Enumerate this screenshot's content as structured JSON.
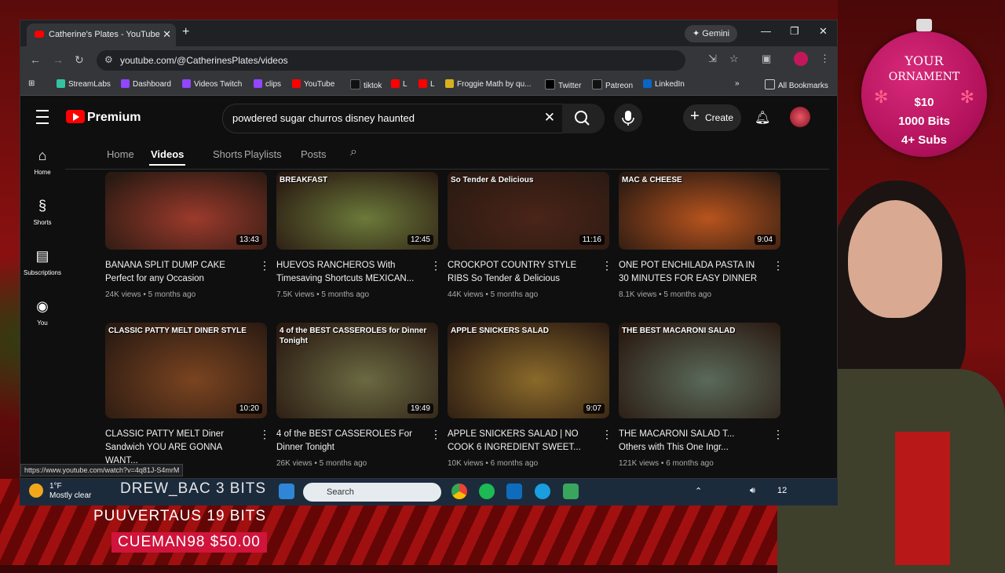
{
  "browser": {
    "tab_title": "Catherine's Plates - YouTube",
    "gemini_label": "Gemini",
    "url": "youtube.com/@CatherinesPlates/videos",
    "bookmarks": [
      "StreamLabs",
      "Dashboard",
      "Videos Twitch",
      "clips",
      "YouTube",
      "tiktok",
      "L",
      "L",
      "Froggie Math by qu...",
      "Twitter",
      "Patreon",
      "LinkedIn"
    ],
    "all_bookmarks": "All Bookmarks",
    "status_url": "https://www.youtube.com/watch?v=4q81J-S4mrM"
  },
  "youtube": {
    "brand": "Premium",
    "search_query": "powdered sugar churros disney haunted",
    "create_label": "Create",
    "sidebar": [
      "Home",
      "Shorts",
      "Subscriptions",
      "You"
    ],
    "tabs": [
      "Home",
      "Videos",
      "Shorts",
      "Playlists",
      "Posts"
    ],
    "videos": [
      {
        "title": "BANANA SPLIT DUMP CAKE Perfect for any Occasion",
        "views": "24K views",
        "age": "5 months ago",
        "duration": "13:43",
        "overlay": "",
        "color": "#9c3a2c"
      },
      {
        "title": "HUEVOS RANCHEROS With Timesaving Shortcuts MEXICAN...",
        "views": "7.5K views",
        "age": "5 months ago",
        "duration": "12:45",
        "overlay": "BREAKFAST",
        "color": "#6b7a3a"
      },
      {
        "title": "CROCKPOT COUNTRY STYLE RIBS So Tender & Delicious",
        "views": "44K views",
        "age": "5 months ago",
        "duration": "11:16",
        "overlay": "So Tender & Delicious",
        "color": "#4a2418"
      },
      {
        "title": "ONE POT ENCHILADA PASTA IN 30 MINUTES FOR EASY DINNER",
        "views": "8.1K views",
        "age": "5 months ago",
        "duration": "9:04",
        "overlay": "MAC & CHEESE",
        "color": "#b8541e"
      },
      {
        "title": "CLASSIC PATTY MELT Diner Sandwich YOU ARE GONNA WANT...",
        "views": "",
        "age": "",
        "duration": "10:20",
        "overlay": "CLASSIC PATTY MELT DINER STYLE",
        "color": "#7a4420"
      },
      {
        "title": "4 of the BEST CASSEROLES For Dinner Tonight",
        "views": "26K views",
        "age": "5 months ago",
        "duration": "19:49",
        "overlay": "4 of the BEST CASSEROLES for Dinner Tonight",
        "color": "#6a6a42"
      },
      {
        "title": "APPLE SNICKERS SALAD | NO COOK 6 INGREDIENT SWEET...",
        "views": "10K views",
        "age": "6 months ago",
        "duration": "9:07",
        "overlay": "APPLE SNICKERS SALAD",
        "color": "#8a6a2a"
      },
      {
        "title": "THE MACARONI SALAD T... Others with This One Ingr...",
        "views": "121K views",
        "age": "6 months ago",
        "duration": "",
        "overlay": "THE BEST MACARONI SALAD",
        "color": "#5a6a5a"
      }
    ]
  },
  "taskbar": {
    "temp": "1°F",
    "weather": "Mostly clear",
    "search": "Search",
    "clock": "12"
  },
  "stream": {
    "alert1": "DREW_BAC  3 BITS",
    "alert2": "PUUVERTAUS  19 BITS",
    "alert3": "CUEMAN98  $50.00",
    "ornament": {
      "l1": "YOUR",
      "l2": "ORNAMENT",
      "l3": "$10",
      "l4": "1000 Bits",
      "l5": "4+ Subs"
    }
  }
}
